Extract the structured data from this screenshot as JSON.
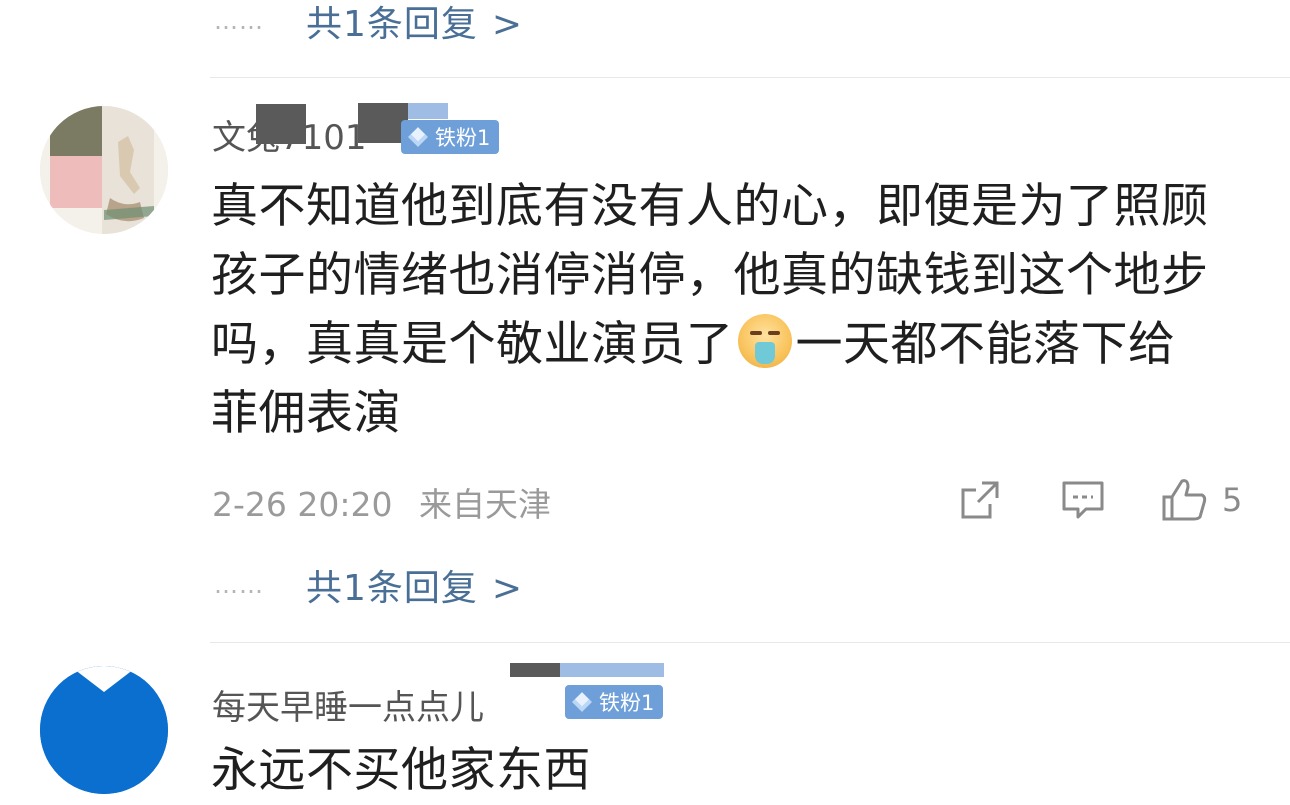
{
  "top_reply": {
    "dots": "……",
    "label": "共1条回复",
    "arrow": ">"
  },
  "comment1": {
    "username": "文兔7101",
    "badge": "铁粉1",
    "text_before_emoji": "真不知道他到底有没有人的心，即便是为了照顾孩子的情绪也消停消停，他真的缺钱到这个地步吗，真真是个敬业演员了",
    "emoji": "emoji-face-icon",
    "text_after_emoji": "一天都不能落下给菲佣表演",
    "date": "2-26 20:20",
    "location": "来自天津",
    "like_count": "5",
    "reply": {
      "dots": "……",
      "label": "共1条回复",
      "arrow": ">"
    }
  },
  "comment2": {
    "username": "每天早睡一点点儿",
    "badge": "铁粉1",
    "text": "永远不买他家东西"
  },
  "colors": {
    "link": "#4a6f96",
    "badge": "#6e9fd9",
    "meta": "#9a9a9a",
    "text": "#1f1f1f"
  }
}
